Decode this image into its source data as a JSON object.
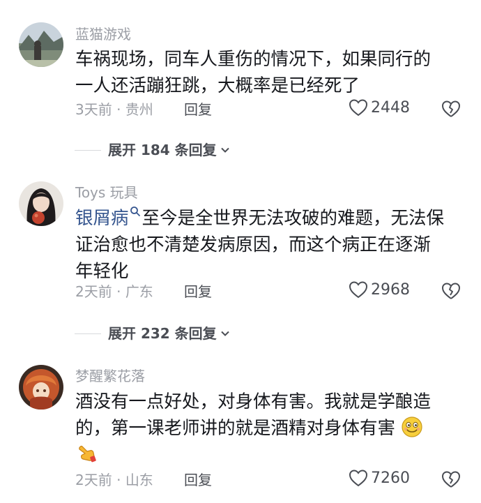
{
  "comments": [
    {
      "username": "蓝猫游戏",
      "text_lines": [
        "车祸现场，同车人重伤的情况下，如果同行的",
        "一人还活蹦狂跳，大概率是已经死了"
      ],
      "time": "3天前",
      "location": "贵州",
      "reply_label": "回复",
      "likes": "2448",
      "expand_label": "展开 184 条回复"
    },
    {
      "username": "Toys 玩具",
      "link_text": "银屑病",
      "text_line1_rest": "至今是全世界无法攻破的难题，无法保",
      "text_line2": "证治愈也不清楚发病原因，而这个病正在逐渐",
      "text_line3": "年轻化",
      "time": "2天前",
      "location": "广东",
      "reply_label": "回复",
      "likes": "2968",
      "expand_label": "展开 232 条回复"
    },
    {
      "username": "梦醒繁花落",
      "text_line1": "酒没有一点好处，对身体有害。我就是学酿造",
      "text_line2": "的，第一课老师讲的就是酒精对身体有害",
      "time": "2天前",
      "location": "山东",
      "reply_label": "回复",
      "likes": "7260"
    }
  ],
  "separator": "·",
  "icons": {
    "like": "heart-outline-icon",
    "dislike": "broken-heart-icon",
    "expand": "chevron-down-icon",
    "search": "search-icon",
    "emoji_smile": "smiling-face-emoji",
    "emoji_point": "pointing-hand-emoji"
  },
  "colors": {
    "text": "#16181d",
    "muted": "#9b9ea5",
    "link": "#36568f",
    "action": "#4a4d54"
  }
}
